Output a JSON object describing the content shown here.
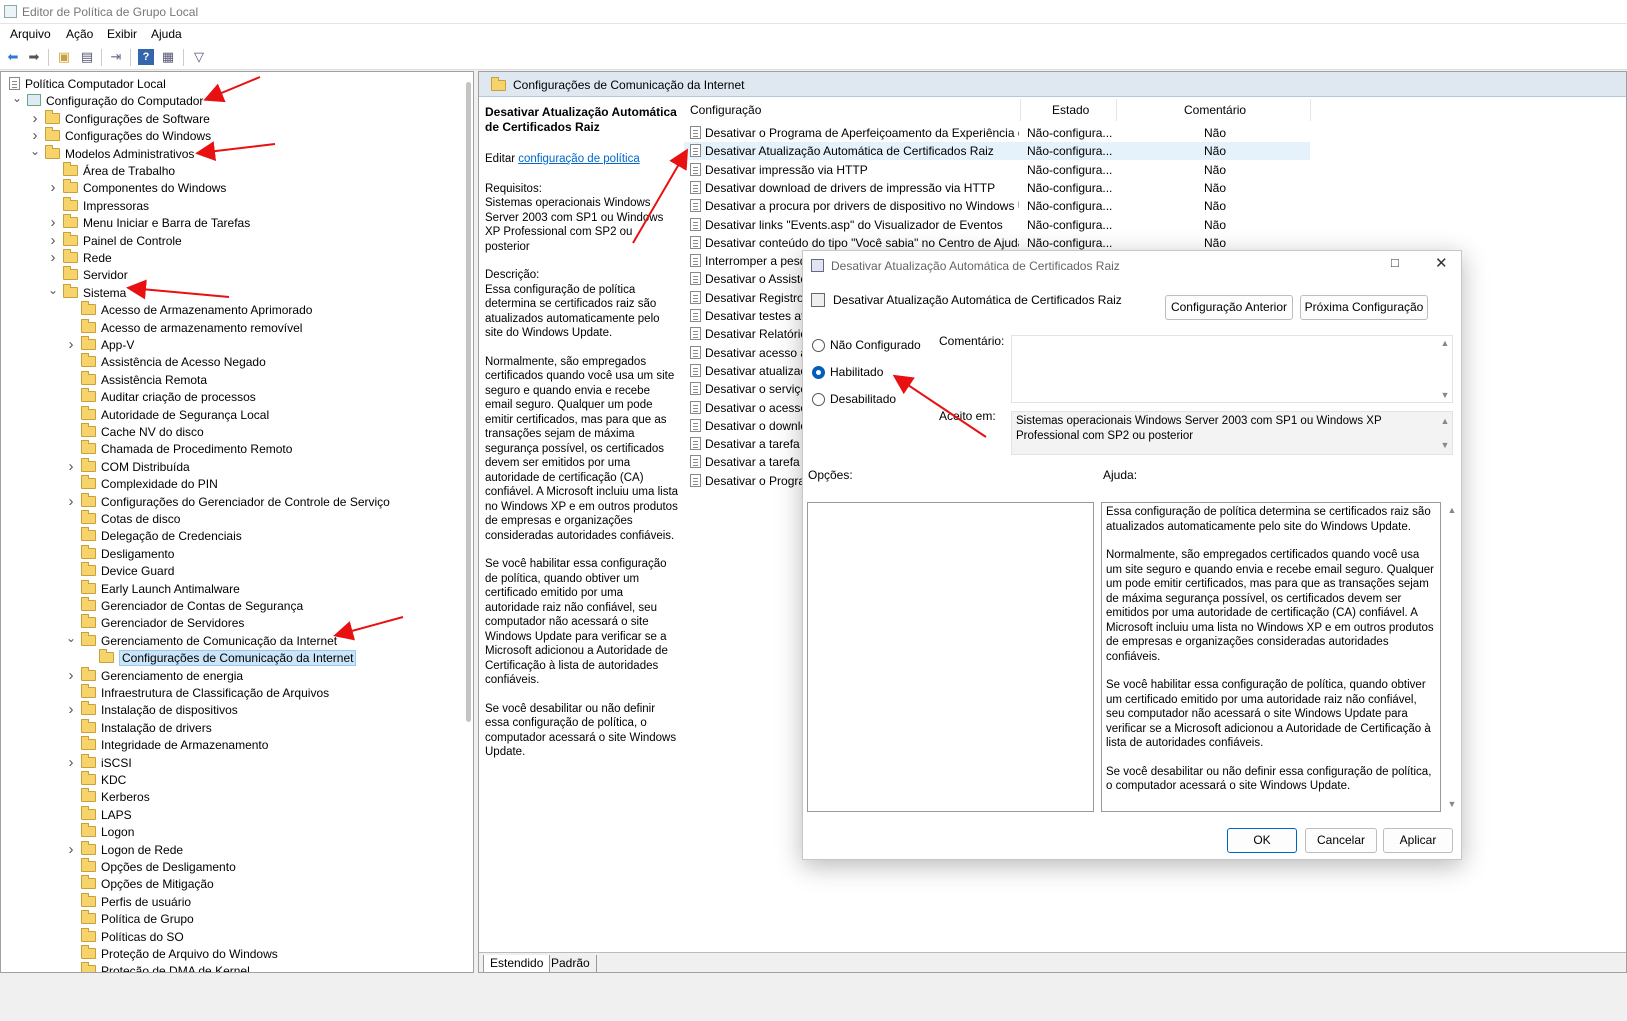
{
  "window": {
    "title": "Editor de Política de Grupo Local"
  },
  "menu": [
    "Arquivo",
    "Ação",
    "Exibir",
    "Ajuda"
  ],
  "toolbar_icons": [
    "back-arrow-icon",
    "forward-arrow-icon",
    "up-folder-icon",
    "show-hide-tree-icon",
    "export-list-icon",
    "help-icon",
    "properties-icon",
    "filter-icon"
  ],
  "tree": {
    "root": "Política Computador Local",
    "computer": "Configuração do Computador",
    "software": "Configurações de Software",
    "windows": "Configurações do Windows",
    "admin": "Modelos Administrativos",
    "admin_children": [
      "Área de Trabalho",
      "Componentes do Windows",
      "Impressoras",
      "Menu Iniciar e Barra de Tarefas",
      "Painel de Controle",
      "Rede",
      "Servidor",
      "Sistema"
    ],
    "sistema_children": [
      "Acesso de Armazenamento Aprimorado",
      "Acesso de armazenamento removível",
      "App-V",
      "Assistência de Acesso Negado",
      "Assistência Remota",
      "Auditar criação de processos",
      "Autoridade de Segurança Local",
      "Cache NV do disco",
      "Chamada de Procedimento Remoto",
      "COM Distribuída",
      "Complexidade do PIN",
      "Configurações do Gerenciador de Controle de Serviço",
      "Cotas de disco",
      "Delegação de Credenciais",
      "Desligamento",
      "Device Guard",
      "Early Launch Antimalware",
      "Gerenciador de Contas de Segurança",
      "Gerenciador de Servidores",
      "Gerenciamento de Comunicação da Internet"
    ],
    "selected": "Configurações de Comunicação da Internet",
    "sistema_children_after": [
      "Gerenciamento de energia",
      "Infraestrutura de Classificação de Arquivos",
      "Instalação de dispositivos",
      "Instalação de drivers",
      "Integridade de Armazenamento",
      "iSCSI",
      "KDC",
      "Kerberos",
      "LAPS",
      "Logon",
      "Logon de Rede",
      "Opções de Desligamento",
      "Opções de Mitigação",
      "Perfis de usuário",
      "Política de Grupo",
      "Políticas do SO",
      "Proteção de Arquivo do Windows",
      "Proteção de DMA de Kernel"
    ]
  },
  "right_header": "Configurações de Comunicação da Internet",
  "description": {
    "title": "Desativar Atualização Automática de Certificados Raiz",
    "edit_prefix": "Editar ",
    "edit_link": "configuração de política",
    "requirements_label": "Requisitos:",
    "requirements": "Sistemas operacionais Windows Server 2003 com SP1 ou Windows XP Professional com SP2 ou posterior",
    "description_label": "Descrição:",
    "paragraphs": [
      "Essa configuração de política determina se certificados raiz são atualizados automaticamente pelo site do Windows Update.",
      "Normalmente, são empregados certificados quando você usa um site seguro e quando envia e recebe email seguro. Qualquer um pode emitir certificados, mas para que as transações sejam de máxima segurança possível, os certificados devem ser emitidos por uma autoridade de certificação (CA) confiável. A Microsoft incluiu uma lista no Windows XP e em outros produtos de empresas e organizações consideradas autoridades confiáveis.",
      "Se você habilitar essa configuração de política, quando obtiver um certificado emitido por uma autoridade raiz não confiável, seu computador não acessará o site Windows Update para verificar se a Microsoft adicionou a Autoridade de Certificação à lista de autoridades confiáveis.",
      "Se você desabilitar ou não definir essa configuração de política, o computador acessará o site Windows Update."
    ]
  },
  "list": {
    "headers": {
      "setting": "Configuração",
      "state": "Estado",
      "comment": "Comentário"
    },
    "rows": [
      {
        "name": "Desativar o Programa de Aperfeiçoamento da Experiência d...",
        "state": "Não-configura...",
        "comment": "Não"
      },
      {
        "name": "Desativar Atualização Automática de Certificados Raiz",
        "state": "Não-configura...",
        "comment": "Não"
      },
      {
        "name": "Desativar impressão via HTTP",
        "state": "Não-configura...",
        "comment": "Não"
      },
      {
        "name": "Desativar download de drivers de impressão via HTTP",
        "state": "Não-configura...",
        "comment": "Não"
      },
      {
        "name": "Desativar a procura por drivers de dispositivo no Windows U...",
        "state": "Não-configura...",
        "comment": "Não"
      },
      {
        "name": "Desativar links \"Events.asp\" do Visualizador de Eventos",
        "state": "Não-configura...",
        "comment": "Não"
      },
      {
        "name": "Desativar conteúdo do tipo \"Você sabia\" no Centro de Ajuda...",
        "state": "Não-configura...",
        "comment": "Não"
      },
      {
        "name": "Interromper a pesq",
        "state": "",
        "comment": ""
      },
      {
        "name": "Desativar o Assister",
        "state": "",
        "comment": ""
      },
      {
        "name": "Desativar Registro s",
        "state": "",
        "comment": ""
      },
      {
        "name": "Desativar testes ativ",
        "state": "",
        "comment": ""
      },
      {
        "name": "Desativar Relatórios",
        "state": "",
        "comment": ""
      },
      {
        "name": "Desativar acesso a t",
        "state": "",
        "comment": ""
      },
      {
        "name": "Desativar atualizaç",
        "state": "",
        "comment": ""
      },
      {
        "name": "Desativar o serviço",
        "state": "",
        "comment": ""
      },
      {
        "name": "Desativar o acesso a",
        "state": "",
        "comment": ""
      },
      {
        "name": "Desativar o downlo",
        "state": "",
        "comment": ""
      },
      {
        "name": "Desativar a tarefa \"E",
        "state": "",
        "comment": ""
      },
      {
        "name": "Desativar a tarefa \"P",
        "state": "",
        "comment": ""
      },
      {
        "name": "Desativar o Program",
        "state": "",
        "comment": ""
      }
    ]
  },
  "tabs": [
    "Estendido",
    "Padrão"
  ],
  "dialog": {
    "title": "Desativar Atualização Automática de Certificados Raiz",
    "setting_name": "Desativar Atualização Automática de Certificados Raiz",
    "prev_button": "Configuração Anterior",
    "next_button": "Próxima Configuração",
    "options": [
      "Não Configurado",
      "Habilitado",
      "Desabilitado"
    ],
    "selected_option": "Habilitado",
    "comment_label": "Comentário:",
    "comment_value": "",
    "supported_label": "Aceito em:",
    "supported_value": "Sistemas operacionais Windows Server 2003 com SP1 ou Windows XP Professional com SP2 ou posterior",
    "options_label": "Opções:",
    "help_label": "Ajuda:",
    "help_paragraphs": [
      "Essa configuração de política determina se certificados raiz são atualizados automaticamente pelo site do Windows Update.",
      "Normalmente, são empregados certificados quando você usa um site seguro e quando envia e recebe email seguro. Qualquer um pode emitir certificados, mas para que as transações sejam de máxima segurança possível, os certificados devem ser emitidos por uma autoridade de certificação (CA) confiável. A Microsoft incluiu uma lista no Windows XP e em outros produtos de empresas e organizações consideradas autoridades confiáveis.",
      "Se você habilitar essa configuração de política, quando obtiver um certificado emitido por uma autoridade raiz não confiável, seu computador não acessará o site Windows Update para verificar se a Microsoft adicionou a Autoridade de Certificação à lista de autoridades confiáveis.",
      "Se você desabilitar ou não definir essa configuração de política, o computador acessará o site Windows Update."
    ],
    "ok": "OK",
    "cancel": "Cancelar",
    "apply": "Aplicar"
  },
  "colors": {
    "accent": "#005fb8",
    "annotation": "#e81010",
    "header_band": "#dfe8f1",
    "selection": "#cce4f7"
  }
}
